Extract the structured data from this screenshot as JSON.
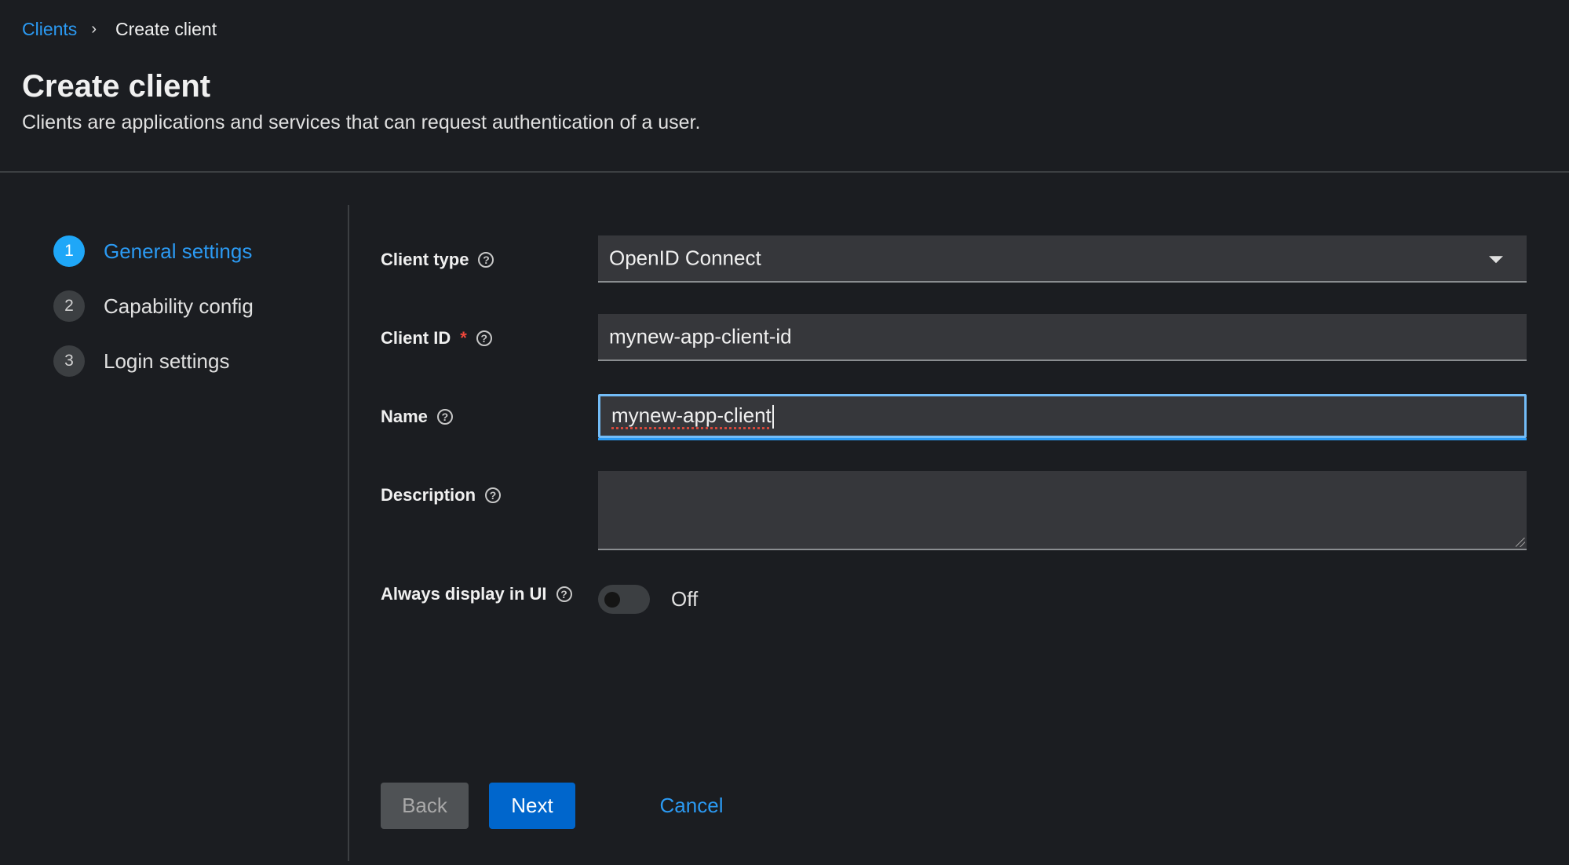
{
  "breadcrumb": {
    "parent": "Clients",
    "separator": "›",
    "current": "Create client"
  },
  "page": {
    "title": "Create client",
    "subtitle": "Clients are applications and services that can request authentication of a user."
  },
  "steps": [
    {
      "number": "1",
      "label": "General settings",
      "active": true
    },
    {
      "number": "2",
      "label": "Capability config",
      "active": false
    },
    {
      "number": "3",
      "label": "Login settings",
      "active": false
    }
  ],
  "form": {
    "client_type": {
      "label": "Client type",
      "value": "OpenID Connect"
    },
    "client_id": {
      "label": "Client ID",
      "required_mark": "*",
      "value": "mynew-app-client-id"
    },
    "name": {
      "label": "Name",
      "value": "mynew-app-client"
    },
    "description": {
      "label": "Description",
      "value": ""
    },
    "always_display": {
      "label": "Always display in UI",
      "state": "Off"
    },
    "help_glyph": "?"
  },
  "buttons": {
    "back": "Back",
    "next": "Next",
    "cancel": "Cancel"
  },
  "colors": {
    "accent": "#2b9af3",
    "primary_button": "#0066cc",
    "background": "#1b1d21",
    "required": "#f0473b"
  }
}
